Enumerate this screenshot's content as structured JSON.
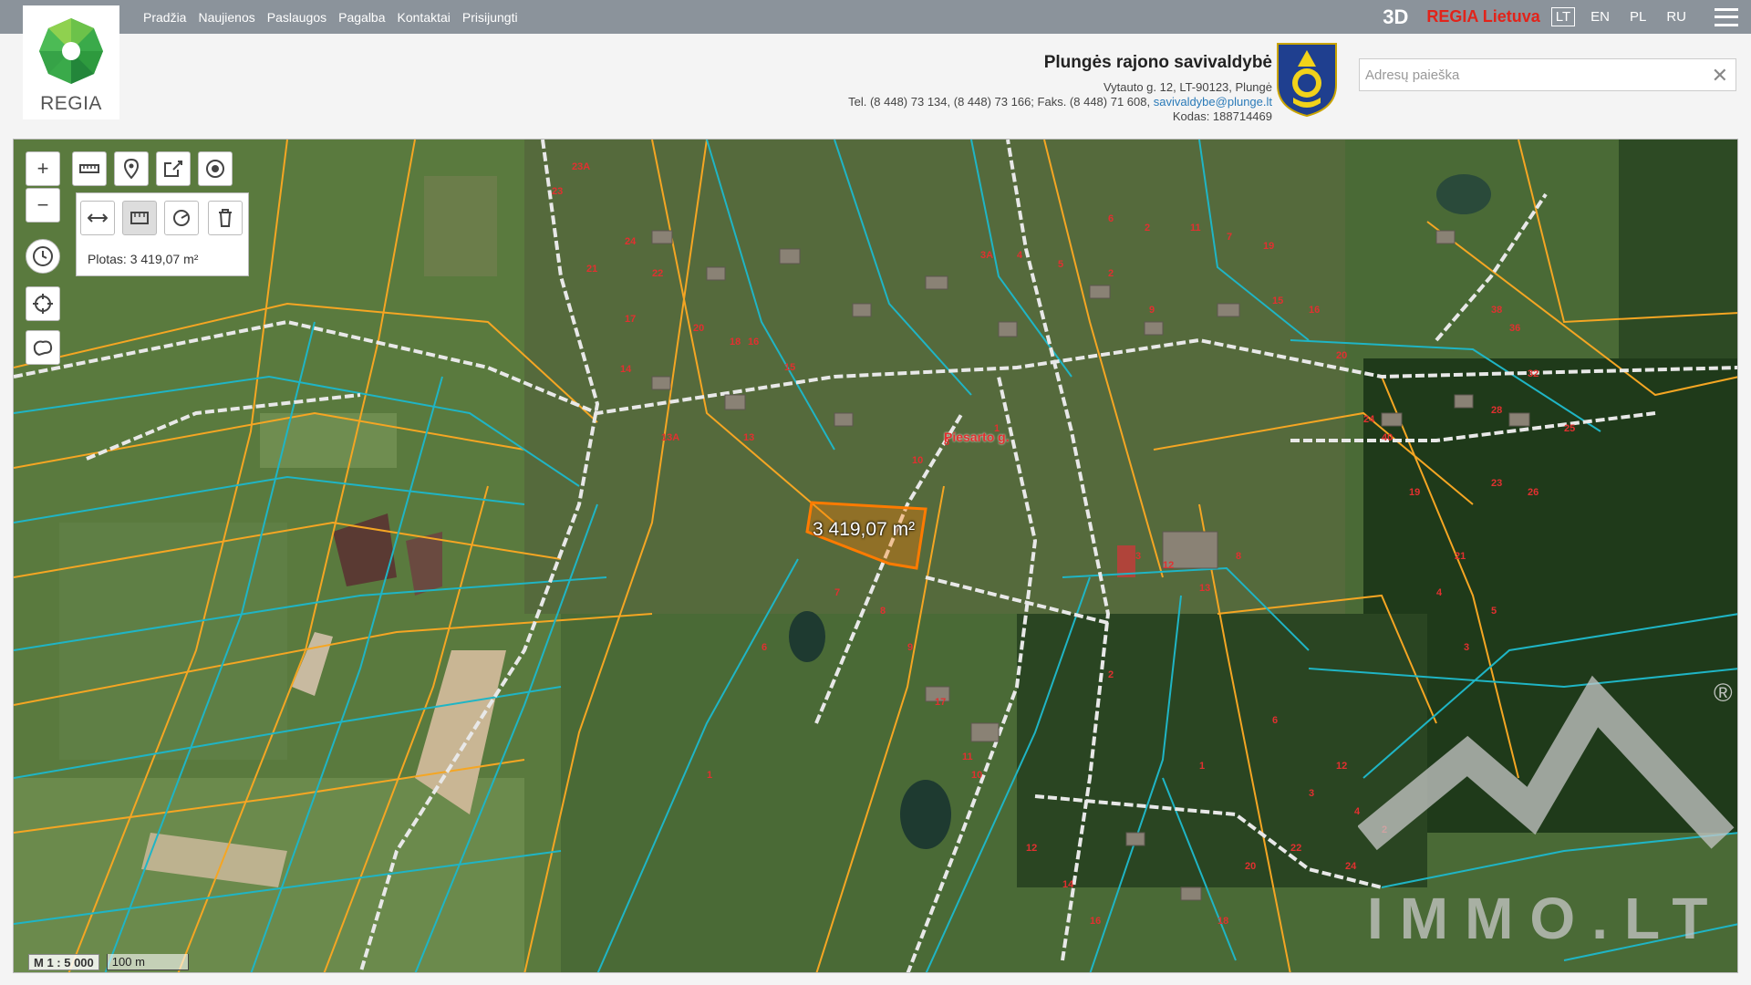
{
  "nav": {
    "items": [
      "Pradžia",
      "Naujienos",
      "Paslaugos",
      "Pagalba",
      "Kontaktai",
      "Prisijungti"
    ]
  },
  "logo": {
    "text": "REGIA"
  },
  "header_right": {
    "btn_3d": "3D",
    "regia_lietuva": "REGIA Lietuva",
    "languages": [
      "LT",
      "EN",
      "PL",
      "RU"
    ],
    "active_language": "LT"
  },
  "municipality": {
    "name": "Plungės rajono savivaldybė",
    "address": "Vytauto g. 12, LT-90123, Plungė",
    "phones": "Tel. (8 448) 73 134, (8 448) 73 166; Faks. (8 448) 71 608, ",
    "email": "savivaldybe@plunge.lt",
    "code": "Kodas: 188714469"
  },
  "search": {
    "placeholder": "Adresų paieška",
    "value": ""
  },
  "map": {
    "measure_result": "Plotas: 3 419,07 m²",
    "area_label": "3 419,07 m²",
    "street_label": "Piesarto g.",
    "scale_ratio": "M 1 : 5 000",
    "scale_distance": "100 m",
    "watermark": "IMMO.LT",
    "watermark_mark": "®"
  },
  "map_labels": [
    "23A",
    "23",
    "24",
    "21",
    "22",
    "17",
    "20",
    "18",
    "16",
    "15",
    "14",
    "13A",
    "13",
    "10",
    "8",
    "1",
    "3A",
    "4",
    "5",
    "6",
    "2",
    "11",
    "7",
    "19",
    "38",
    "36",
    "32",
    "28",
    "25",
    "26",
    "23",
    "8",
    "13",
    "12",
    "3",
    "9",
    "2",
    "15",
    "16",
    "20",
    "24",
    "40",
    "19",
    "21",
    "4",
    "5",
    "3",
    "2",
    "1",
    "6",
    "12",
    "3",
    "4",
    "2",
    "24",
    "22",
    "20",
    "18",
    "16",
    "14",
    "12",
    "10",
    "11",
    "17",
    "9",
    "8",
    "7",
    "6",
    "1"
  ],
  "colors": {
    "topbar": "#8b939b",
    "regia_red": "#e2231a",
    "parcel_orange": "#f5a623",
    "parcel_cyan": "#1fb5c5",
    "selected_parcel": "#ff7b00"
  }
}
